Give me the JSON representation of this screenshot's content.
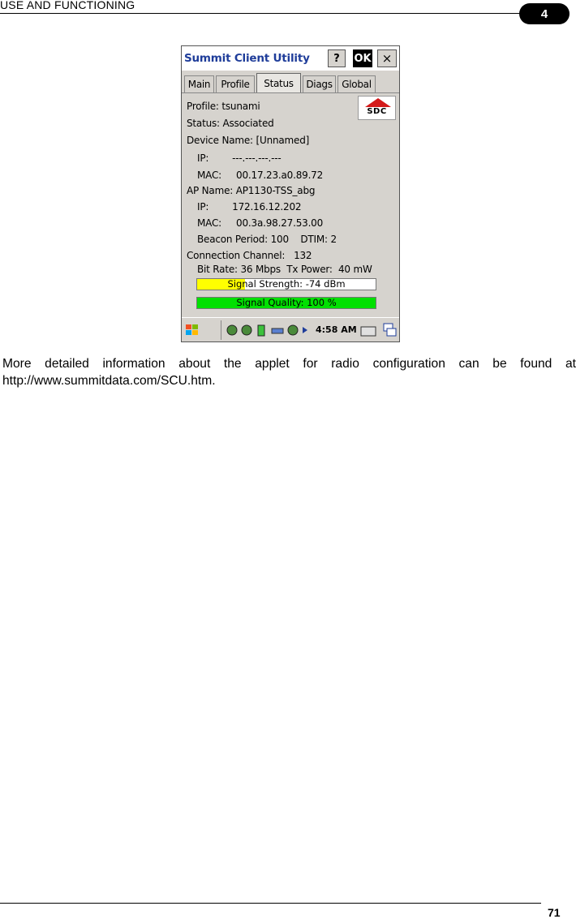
{
  "header": {
    "section_title": "USE AND FUNCTIONING",
    "chapter_number": "4"
  },
  "screenshot": {
    "app_title": "Summit Client Utility",
    "buttons": {
      "help": "?",
      "ok": "OK",
      "close": "×"
    },
    "tabs": [
      "Main",
      "Profile",
      "Status",
      "Diags",
      "Global"
    ],
    "active_tab": "Status",
    "logo_text": "SDC",
    "status": {
      "profile": "Profile: tsunami",
      "status": "Status: Associated",
      "device_name": "Device Name: [Unnamed]",
      "device_ip": "IP:        ---.---.---.---",
      "device_mac": "MAC:     00.17.23.a0.89.72",
      "ap_name": "AP Name: AP1130-TSS_abg",
      "ap_ip": "IP:        172.16.12.202",
      "ap_mac": "MAC:     00.3a.98.27.53.00",
      "beacon": "Beacon Period: 100    DTIM: 2",
      "channel": "Connection Channel:   132",
      "bitrate": "Bit Rate: 36 Mbps  Tx Power:  40 mW"
    },
    "signal_strength": {
      "label": "Signal Strength: -74 dBm",
      "level": 0.27,
      "color": "#ffff00"
    },
    "signal_quality": {
      "label": "Signal Quality: 100 %",
      "level": 1.0,
      "color": "#00e000"
    },
    "taskbar": {
      "time": "4:58 AM"
    }
  },
  "caption": "More detailed information about the applet for radio configuration can be found at http://www.summitdata.com/SCU.htm.",
  "footer": {
    "page_number": "71"
  }
}
